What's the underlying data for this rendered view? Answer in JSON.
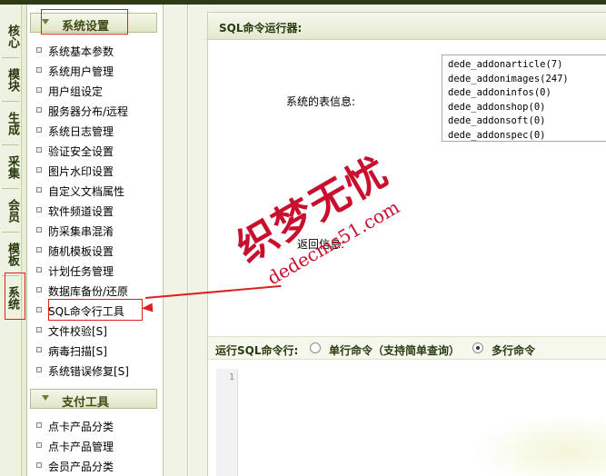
{
  "vertical_tabs": [
    {
      "label": "核心"
    },
    {
      "label": "模块"
    },
    {
      "label": "生成"
    },
    {
      "label": "采集"
    },
    {
      "label": "会员"
    },
    {
      "label": "模板"
    },
    {
      "label": "系统"
    }
  ],
  "menu": {
    "groups": [
      {
        "title": "系统设置",
        "items": [
          "系统基本参数",
          "系统用户管理",
          "用户组设定",
          "服务器分布/远程",
          "系统日志管理",
          "验证安全设置",
          "图片水印设置",
          "自定义文档属性",
          "软件频道设置",
          "防采集串混淆",
          "随机模板设置",
          "计划任务管理",
          "数据库备份/还原",
          "SQL命令行工具",
          "文件校验[S]",
          "病毒扫描[S]",
          "系统错误修复[S]"
        ]
      },
      {
        "title": "支付工具",
        "items": [
          "点卡产品分类",
          "点卡产品管理",
          "会员产品分类"
        ]
      }
    ]
  },
  "main": {
    "title": "SQL命令运行器:",
    "table_info_label": "系统的表信息:",
    "tables": [
      "dede_addonarticle(7)",
      "dede_addonimages(247)",
      "dede_addoninfos(0)",
      "dede_addonshop(0)",
      "dede_addonsoft(0)",
      "dede_addonspec(0)"
    ],
    "return_info_label": "返回信息:",
    "run_sql_label": "运行SQL命令行:",
    "mode_options": [
      {
        "label": "单行命令（支持简单查询）",
        "checked": false
      },
      {
        "label": "多行命令",
        "checked": true
      }
    ],
    "editor_line_number": "1"
  },
  "watermark": {
    "chinese": "织梦无忧",
    "url": "dedecms51.com"
  },
  "colors": {
    "annotation_red": "#e02020",
    "watermark_red": "#c8102e",
    "header_green": "#3e4b16"
  }
}
